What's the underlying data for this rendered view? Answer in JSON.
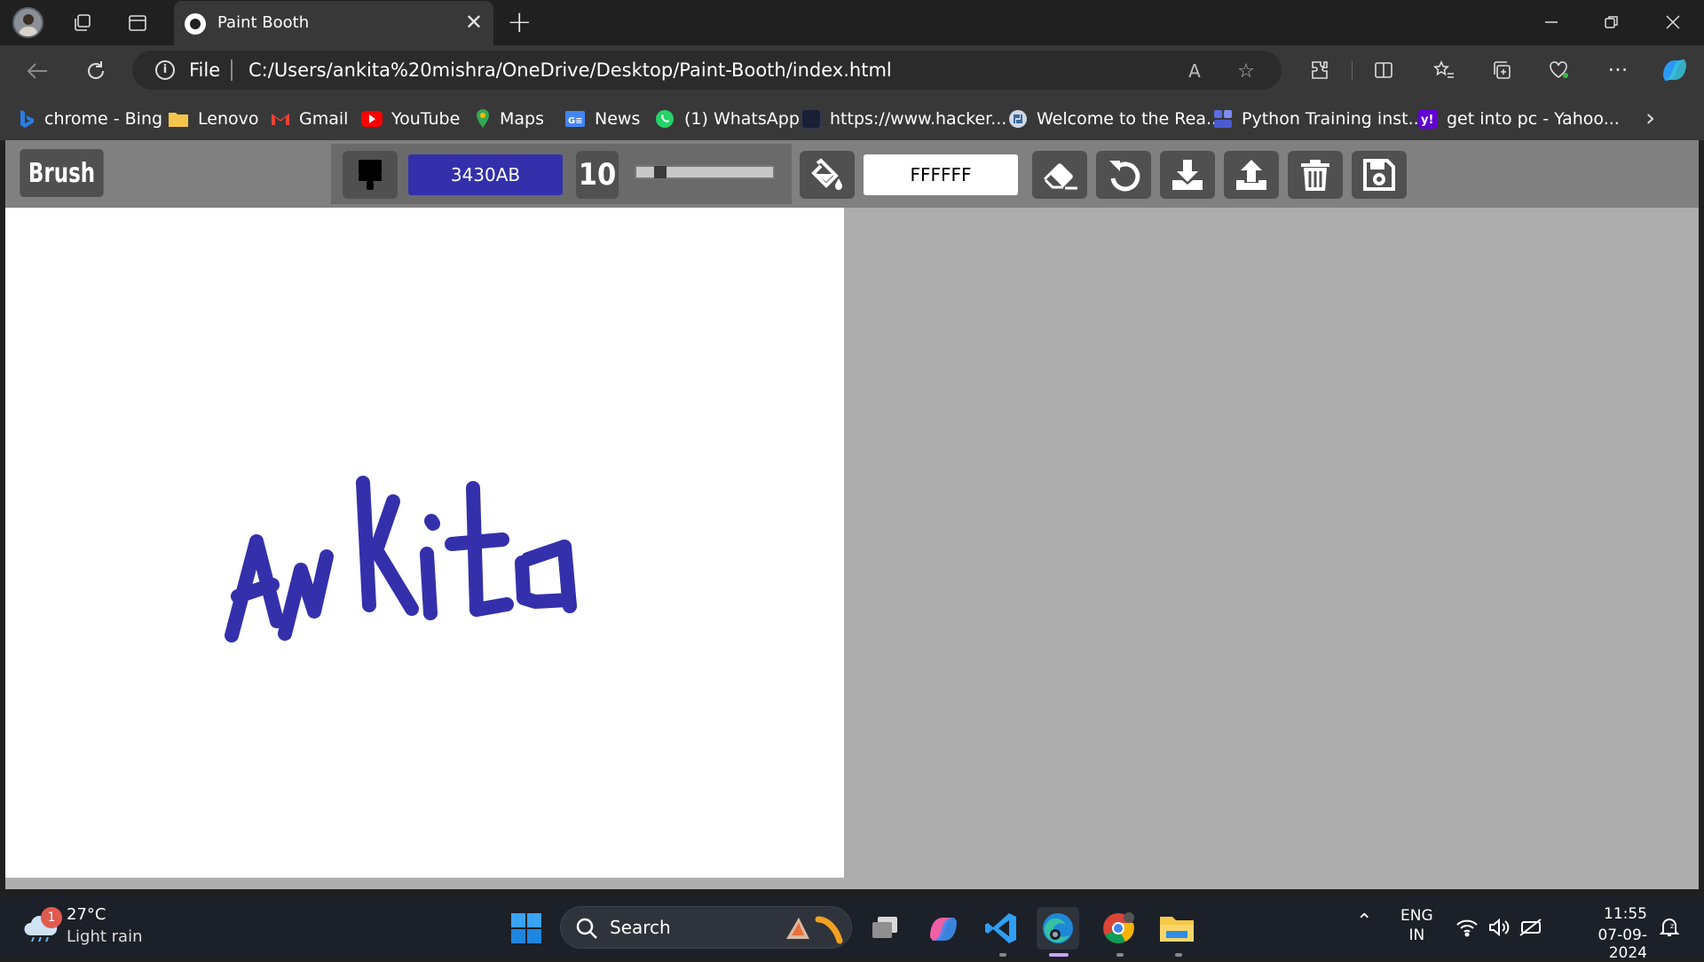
{
  "browser": {
    "tab_title": "Paint Booth",
    "address": {
      "scheme_label": "File",
      "url": "C:/Users/ankita%20mishra/OneDrive/Desktop/Paint-Booth/index.html"
    },
    "bookmarks": [
      {
        "label": "chrome - Bing",
        "icon": "bing-icon",
        "color": "#2a7de1"
      },
      {
        "label": "Lenovo",
        "icon": "folder-icon",
        "color": "#f3c64b"
      },
      {
        "label": "Gmail",
        "icon": "gmail-icon",
        "color": "#ea4335"
      },
      {
        "label": "YouTube",
        "icon": "youtube-icon",
        "color": "#ff0000"
      },
      {
        "label": "Maps",
        "icon": "maps-icon",
        "color": "#34a853"
      },
      {
        "label": "News",
        "icon": "news-icon",
        "color": "#4285f4"
      },
      {
        "label": "(1) WhatsApp",
        "icon": "whatsapp-icon",
        "color": "#25d366"
      },
      {
        "label": "https://www.hacker...",
        "icon": "hackerrank-icon",
        "color": "#1a1f36"
      },
      {
        "label": "Welcome to the Rea...",
        "icon": "python-icon",
        "color": "#cfd8e6"
      },
      {
        "label": "Python Training inst...",
        "icon": "training-icon",
        "color": "#5b6ee1"
      },
      {
        "label": "get into pc - Yahoo...",
        "icon": "yahoo-icon",
        "color": "#6001d2"
      }
    ]
  },
  "app": {
    "mode_label": "Brush",
    "brush_color": "3430AB",
    "brush_color_hex": "#3430AB",
    "brush_size": "10",
    "brush_size_fraction": 0.14,
    "background_color": "FFFFFF",
    "background_color_hex": "#FFFFFF",
    "drawing_text": "Ankita"
  },
  "taskbar": {
    "weather_temp": "27°C",
    "weather_desc": "Light rain",
    "weather_badge": "1",
    "search_label": "Search",
    "lang_top": "ENG",
    "lang_bottom": "IN",
    "time": "11:55",
    "date": "07-09-2024"
  }
}
